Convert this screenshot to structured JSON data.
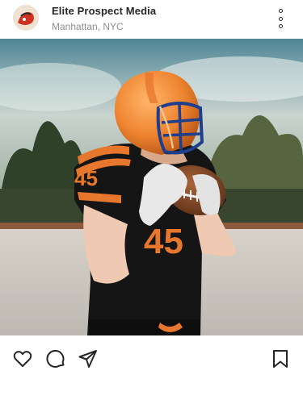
{
  "post": {
    "account_name": "Elite Prospect Media",
    "location": "Manhattan, NYC",
    "avatar_icon": "team-logo-avatar",
    "image_icon": "football-player-photo",
    "jersey_number": "45"
  },
  "actions": {
    "like_icon": "heart-icon",
    "comment_icon": "comment-icon",
    "share_icon": "send-icon",
    "save_icon": "bookmark-icon"
  },
  "colors": {
    "text_primary": "#262626",
    "text_secondary": "#8e8e8e",
    "jersey_orange": "#e8772e",
    "jersey_black": "#141414"
  }
}
